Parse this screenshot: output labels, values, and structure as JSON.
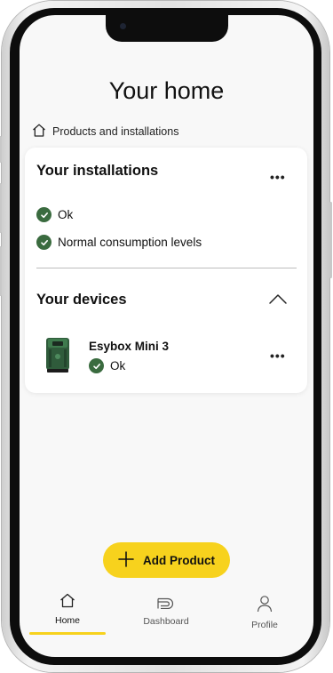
{
  "page": {
    "title": "Your home",
    "breadcrumb": "Products and installations"
  },
  "installations": {
    "heading": "Your installations",
    "menu_icon": "more-horizontal-icon",
    "statuses": [
      {
        "label": "Ok",
        "icon": "check-circle-icon"
      },
      {
        "label": "Normal consumption levels",
        "icon": "check-circle-icon"
      }
    ]
  },
  "devices": {
    "heading": "Your devices",
    "toggle_icon": "chevron-up-icon",
    "items": [
      {
        "name": "Esybox Mini 3",
        "status": "Ok",
        "status_icon": "check-circle-icon",
        "menu_icon": "more-horizontal-icon"
      }
    ]
  },
  "actions": {
    "add_product_label": "Add Product",
    "add_icon": "plus-icon"
  },
  "tabbar": {
    "tabs": [
      {
        "label": "Home",
        "icon": "home-icon",
        "active": true
      },
      {
        "label": "Dashboard",
        "icon": "dashboard-icon",
        "active": false
      },
      {
        "label": "Profile",
        "icon": "user-icon",
        "active": false
      }
    ]
  },
  "colors": {
    "accent": "#f7d21d",
    "status_ok": "#3a6b3f",
    "screen_bg": "#f8f8f8",
    "card_bg": "#ffffff"
  }
}
